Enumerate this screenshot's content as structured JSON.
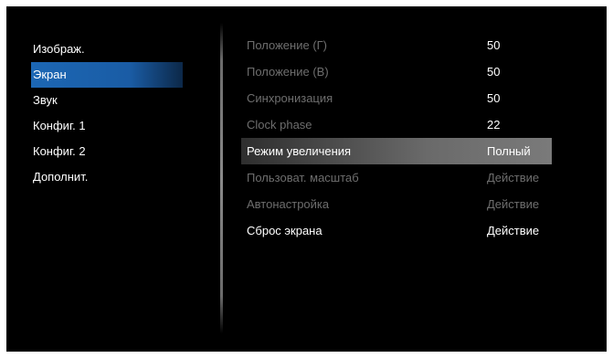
{
  "left_menu": {
    "items": [
      {
        "label": "Изображ."
      },
      {
        "label": "Экран",
        "selected": true
      },
      {
        "label": "Звук"
      },
      {
        "label": "Конфиг. 1"
      },
      {
        "label": "Конфиг. 2"
      },
      {
        "label": "Дополнит."
      }
    ]
  },
  "settings": {
    "rows": [
      {
        "label": "Положение (Г)",
        "value": "50"
      },
      {
        "label": "Положение (В)",
        "value": "50"
      },
      {
        "label": "Синхронизация",
        "value": "50"
      },
      {
        "label": "Clock phase",
        "value": "22"
      },
      {
        "label": "Режим увеличения",
        "value": "Полный"
      },
      {
        "label": "Пользоват. масштаб",
        "value": "Действие"
      },
      {
        "label": "Автонастройка",
        "value": "Действие"
      },
      {
        "label": "Сброс экрана",
        "value": "Действие"
      }
    ]
  },
  "colors": {
    "selected_tab": "#1c67b4",
    "highlight_row": "#6a6a6a",
    "dim_text": "#6e6e6e",
    "text": "#ffffff",
    "background": "#000000"
  }
}
